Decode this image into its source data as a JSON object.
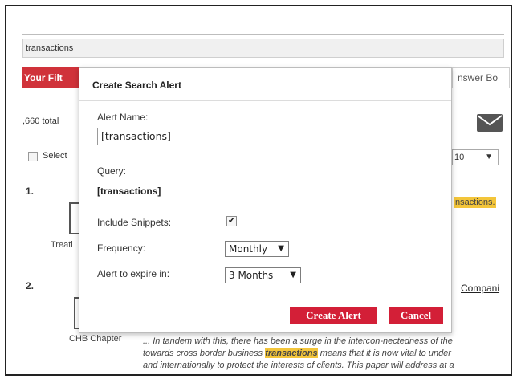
{
  "background": {
    "search_text": "transactions",
    "filter_button": "Your Filt",
    "answer_button": "nswer Bo",
    "total_text": ",660 total",
    "select_label": "Select",
    "per_page": "10",
    "result_1_number": "1.",
    "result_1_type": "Treati",
    "result_1_highlight": "nsactions.",
    "result_2_number": "2.",
    "result_2_title": "Compani",
    "result_2_type": "CHB Chapter",
    "snippet_line1": "... In tandem with this, there has been a surge in the intercon-nectedness of the",
    "snippet_line2_pre": "towards cross border business ",
    "snippet_keyword": "transactions",
    "snippet_line2_post": " means that it is now vital to under",
    "snippet_line3": "and internationally to protect the interests of clients. This paper will address at a"
  },
  "modal": {
    "title": "Create Search Alert",
    "alert_name_label": "Alert Name:",
    "alert_name_value": "[transactions]",
    "query_label": "Query:",
    "query_value": "[transactions]",
    "include_snippets_label": "Include Snippets:",
    "include_snippets_checked": true,
    "frequency_label": "Frequency:",
    "frequency_value": "Monthly",
    "expire_label": "Alert to expire in:",
    "expire_value": "3 Months",
    "create_button": "Create Alert",
    "cancel_button": "Cancel"
  },
  "colors": {
    "accent_red": "#d31f37",
    "highlight": "#f3c53a"
  }
}
